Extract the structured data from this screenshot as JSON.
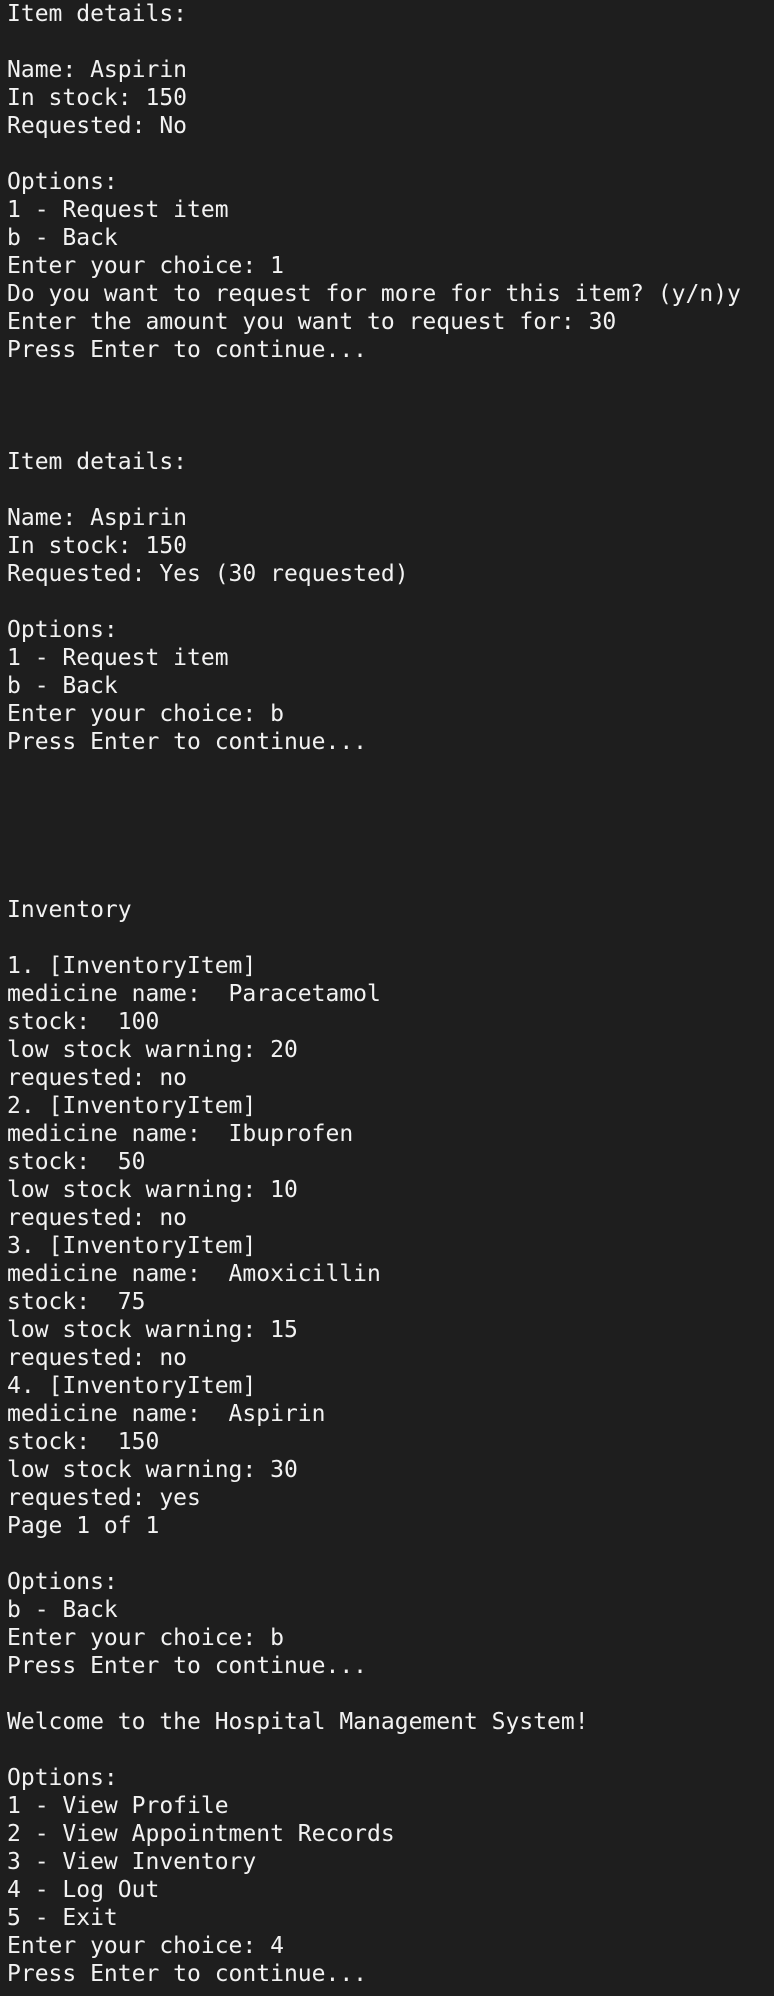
{
  "terminal": {
    "lines": [
      "Item details:",
      "",
      "Name: Aspirin",
      "In stock: 150",
      "Requested: No",
      "",
      "Options:",
      "1 - Request item",
      "b - Back",
      "Enter your choice: 1",
      "Do you want to request for more for this item? (y/n)y",
      "Enter the amount you want to request for: 30",
      "Press Enter to continue...",
      "",
      "",
      "",
      "Item details:",
      "",
      "Name: Aspirin",
      "In stock: 150",
      "Requested: Yes (30 requested)",
      "",
      "Options:",
      "1 - Request item",
      "b - Back",
      "Enter your choice: b",
      "Press Enter to continue...",
      "",
      "",
      "",
      "",
      "",
      "Inventory",
      "",
      "1. [InventoryItem]",
      "medicine name:  Paracetamol",
      "stock:  100",
      "low stock warning: 20",
      "requested: no",
      "2. [InventoryItem]",
      "medicine name:  Ibuprofen",
      "stock:  50",
      "low stock warning: 10",
      "requested: no",
      "3. [InventoryItem]",
      "medicine name:  Amoxicillin",
      "stock:  75",
      "low stock warning: 15",
      "requested: no",
      "4. [InventoryItem]",
      "medicine name:  Aspirin",
      "stock:  150",
      "low stock warning: 30",
      "requested: yes",
      "Page 1 of 1",
      "",
      "Options:",
      "b - Back",
      "Enter your choice: b",
      "Press Enter to continue...",
      "",
      "Welcome to the Hospital Management System!",
      "",
      "Options:",
      "1 - View Profile",
      "2 - View Appointment Records",
      "3 - View Inventory",
      "4 - Log Out",
      "5 - Exit",
      "Enter your choice: 4",
      "Press Enter to continue..."
    ]
  }
}
